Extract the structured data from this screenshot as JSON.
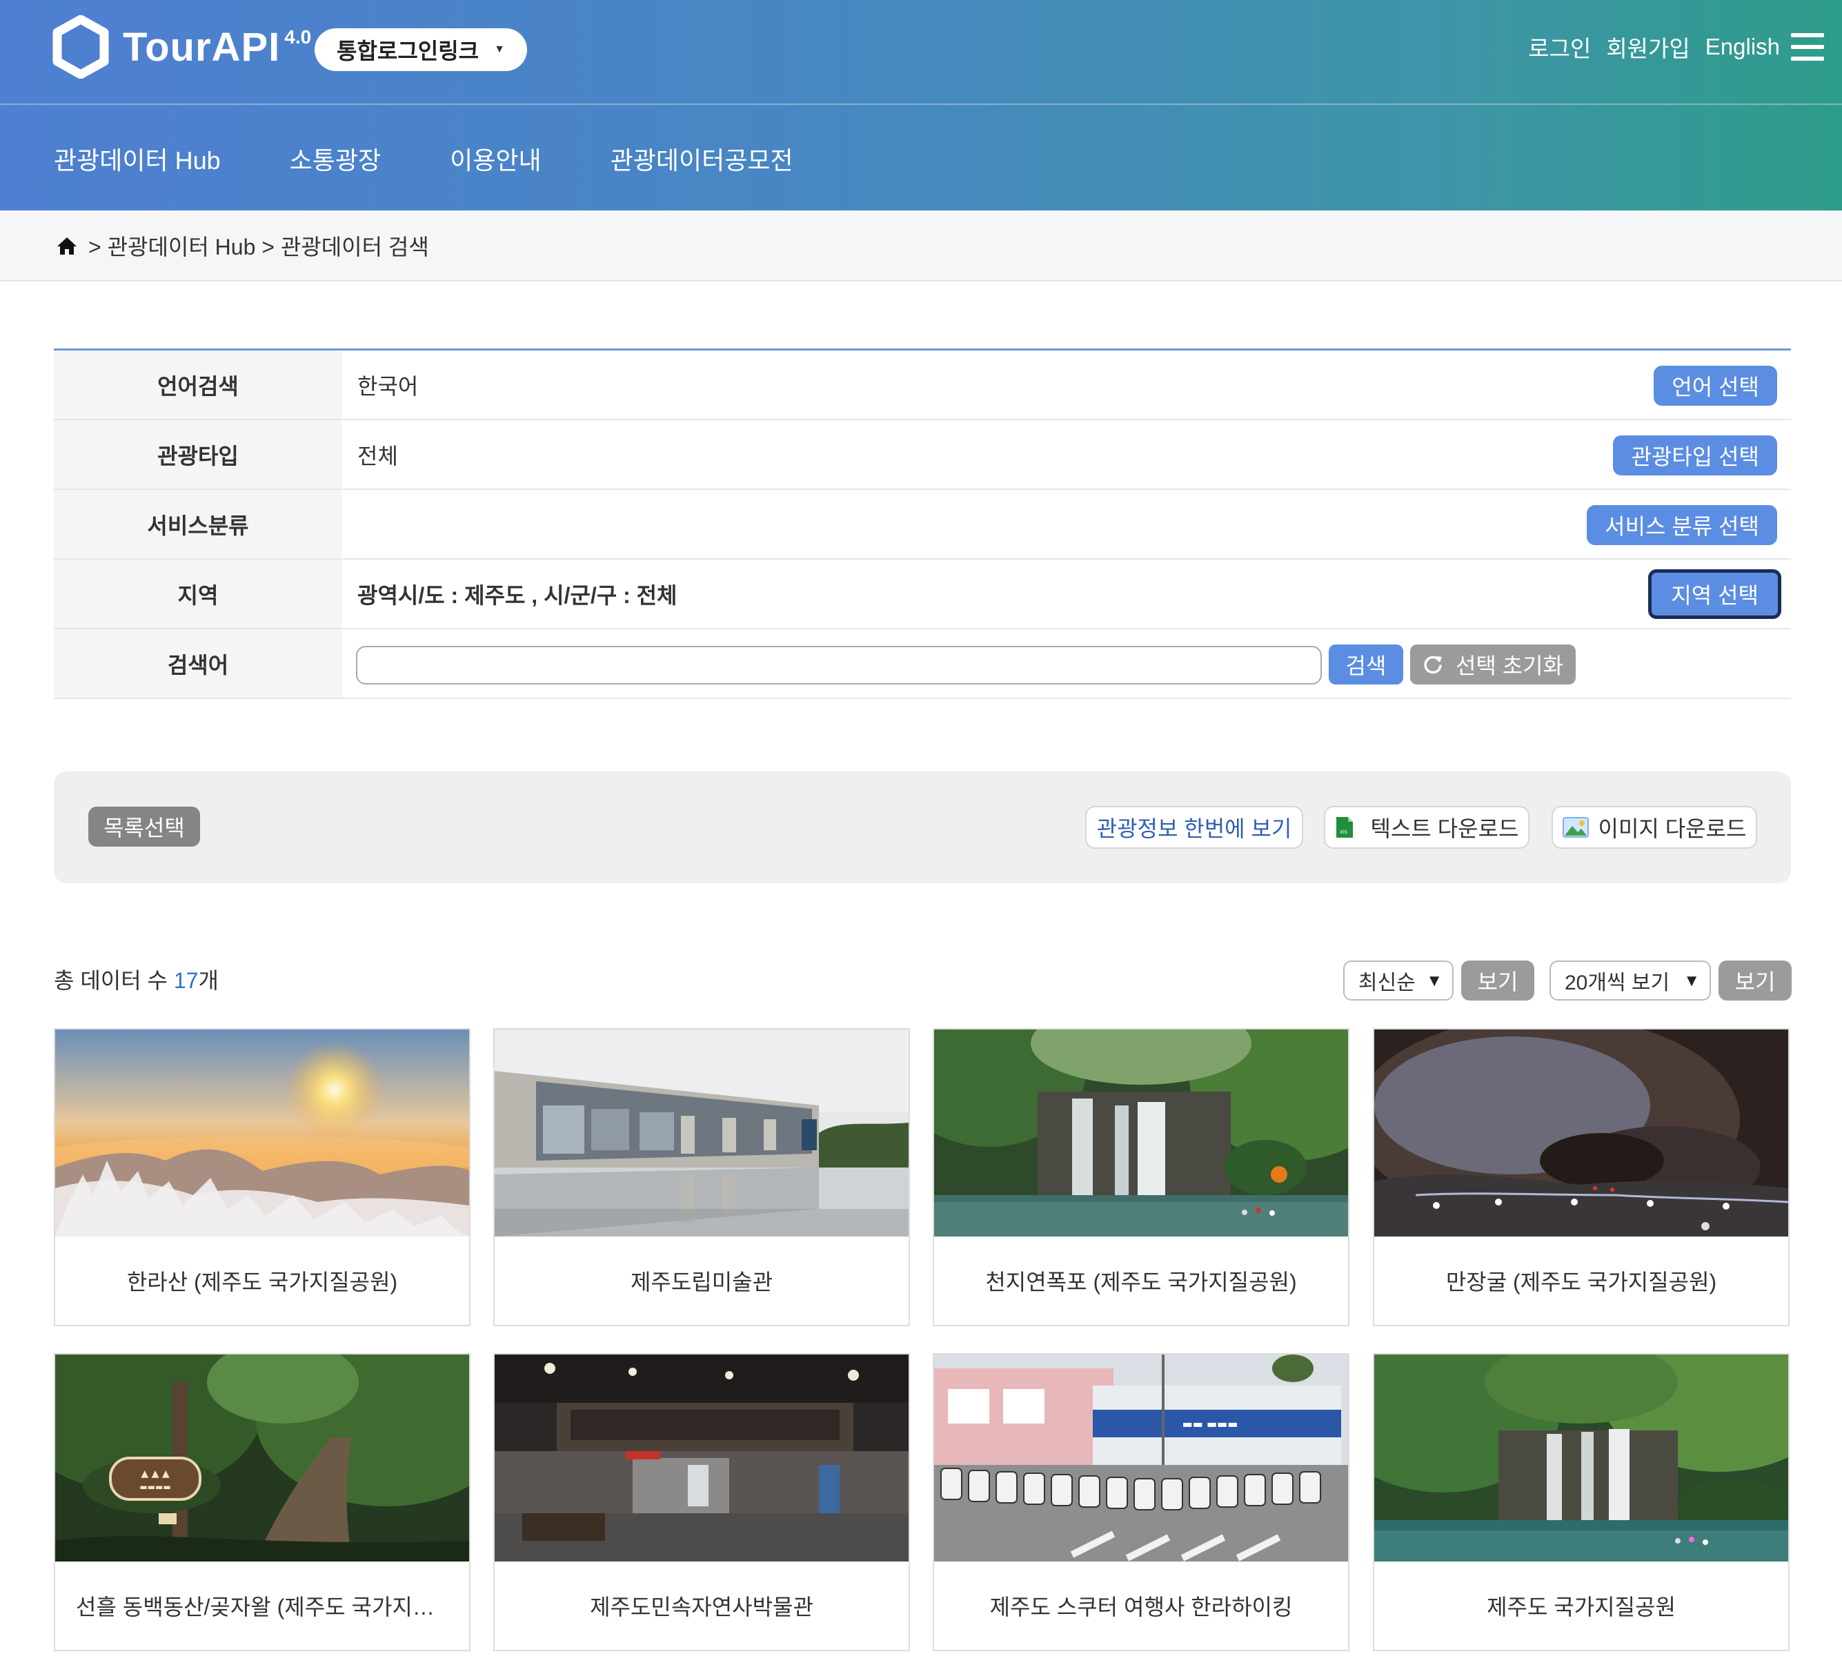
{
  "header": {
    "logo_text": "TourAPI",
    "logo_version": "4.0",
    "sso_label": "통합로그인링크",
    "links": {
      "login": "로그인",
      "signup": "회원가입",
      "english": "English"
    },
    "nav": [
      "관광데이터 Hub",
      "소통광장",
      "이용안내",
      "관광데이터공모전"
    ],
    "gradient_colors": [
      "#4f7fd1",
      "#2e9c8a"
    ]
  },
  "breadcrumb": {
    "text": "> 관광데이터 Hub > 관광데이터 검색"
  },
  "search_form": {
    "rows": [
      {
        "label": "언어검색",
        "value": "한국어",
        "button": "언어 선택"
      },
      {
        "label": "관광타입",
        "value": "전체",
        "button": "관광타입 선택"
      },
      {
        "label": "서비스분류",
        "value": "",
        "button": "서비스 분류 선택"
      },
      {
        "label": "지역",
        "value": "광역시/도 : 제주도 ,  시/군/구 : 전체",
        "button": "지역 선택"
      },
      {
        "label": "검색어",
        "value": "",
        "placeholder": ""
      }
    ],
    "search_button": "검색",
    "reset_button": "선택 초기화",
    "accent_color": "#5b8de2"
  },
  "action_bar": {
    "list_select": "목록선택",
    "view_all": "관광정보 한번에 보기",
    "text_download": "텍스트 다운로드",
    "image_download": "이미지 다운로드"
  },
  "results": {
    "total_prefix": "총 데이터 수 ",
    "total_count": "17",
    "total_suffix": "개",
    "sort_selected": "최신순",
    "sort_view_button": "보기",
    "page_size_selected": "20개씩 보기",
    "page_size_view_button": "보기"
  },
  "cards": [
    {
      "title": "한라산 (제주도 국가지질공원)",
      "image": "sunrise-over-clouds"
    },
    {
      "title": "제주도립미술관",
      "image": "museum-reflecting-pool"
    },
    {
      "title": "천지연폭포 (제주도 국가지질공원)",
      "image": "waterfall-forest"
    },
    {
      "title": "만장굴 (제주도 국가지질공원)",
      "image": "lava-cave"
    },
    {
      "title": "선흘 동백동산/곶자왈 (제주도 국가지질공원)",
      "image": "forest-trail-sign"
    },
    {
      "title": "제주도민속자연사박물관",
      "image": "museum-interior"
    },
    {
      "title": "제주도 스쿠터 여행사 한라하이킹",
      "image": "scooter-rental-shop"
    },
    {
      "title": "제주도 국가지질공원",
      "image": "waterfall-pool"
    }
  ]
}
